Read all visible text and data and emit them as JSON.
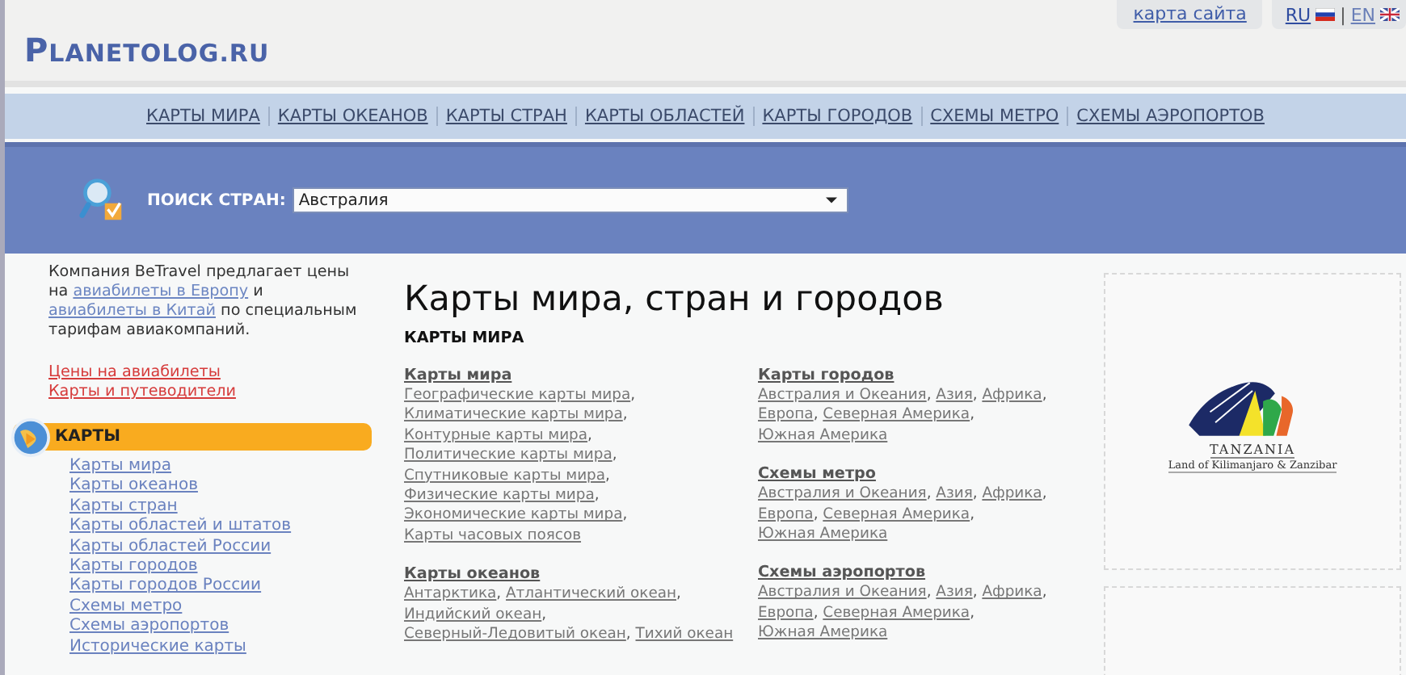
{
  "header": {
    "logo": "PLANETOLOG.RU",
    "sitemap_link": "карта сайта",
    "languages": [
      {
        "code": "RU",
        "selected": true
      },
      {
        "code": "EN",
        "selected": false
      }
    ],
    "language_separator": "|"
  },
  "nav": [
    "КАРТЫ МИРА",
    "КАРТЫ ОКЕАНОВ",
    "КАРТЫ СТРАН",
    "КАРТЫ ОБЛАСТЕЙ",
    "КАРТЫ ГОРОДОВ",
    "СХЕМЫ МЕТРО",
    "СХЕМЫ АЭРОПОРТОВ"
  ],
  "search": {
    "label": "ПОИСК СТРАН:",
    "value": "Австралия"
  },
  "sidebar": {
    "promo": [
      {
        "text": "Компания BeTravel предлагает цены на ",
        "link": false
      },
      {
        "text": "авиабилеты в Европу",
        "link": true
      },
      {
        "text": " и ",
        "link": false
      },
      {
        "text": "авиабилеты в Китай",
        "link": true
      },
      {
        "text": " по специальным тарифам авиакомпаний.",
        "link": false
      }
    ],
    "red_links": [
      "Цены на авиабилеты",
      "Карты и путеводители"
    ],
    "section_title": "КАРТЫ",
    "items": [
      "Карты мира",
      "Карты океанов",
      "Карты стран",
      "Карты областей и штатов",
      "Карты областей России",
      "Карты городов",
      "Карты городов России",
      "Схемы метро",
      "Схемы аэропортов",
      "Исторические карты"
    ]
  },
  "main": {
    "title": "Карты мира, стран и городов",
    "subtitle": "КАРТЫ МИРА",
    "columns": [
      [
        {
          "heading": "Карты мира",
          "links": [
            {
              "text": "Географические карты мира",
              "sep": ","
            },
            {
              "text": "Климатические карты мира",
              "sep": ","
            },
            {
              "text": "Контурные карты мира",
              "sep": ","
            },
            {
              "text": "Политические карты мира",
              "sep": ","
            },
            {
              "text": "Спутниковые карты мира",
              "sep": ","
            },
            {
              "text": "Физические карты мира",
              "sep": ","
            },
            {
              "text": "Экономические карты мира",
              "sep": ","
            },
            {
              "text": "Карты часовых поясов"
            }
          ]
        },
        {
          "heading": "Карты океанов",
          "links": [
            {
              "text": "Антарктика",
              "sep": ","
            },
            {
              "text": "Атлантический океан",
              "sep": ","
            },
            {
              "text": "Индийский океан",
              "sep": ","
            },
            {
              "text": "Северный-Ледовитый океан",
              "sep": ","
            },
            {
              "text": "Тихий океан"
            }
          ]
        }
      ],
      [
        {
          "heading": "Карты городов",
          "links": [
            {
              "text": "Австралия и Океания",
              "sep": ","
            },
            {
              "text": "Азия",
              "sep": ","
            },
            {
              "text": "Африка",
              "sep": ","
            },
            {
              "text": "Европа",
              "sep": ","
            },
            {
              "text": "Северная Америка",
              "sep": ","
            },
            {
              "text": "Южная Америка"
            }
          ]
        },
        {
          "heading": "Схемы метро",
          "links": [
            {
              "text": "Австралия и Океания",
              "sep": ","
            },
            {
              "text": "Азия",
              "sep": ","
            },
            {
              "text": "Африка",
              "sep": ","
            },
            {
              "text": "Европа",
              "sep": ","
            },
            {
              "text": "Северная Америка",
              "sep": ","
            },
            {
              "text": "Южная Америка"
            }
          ]
        },
        {
          "heading": "Схемы аэропортов",
          "links": [
            {
              "text": "Австралия и Океания",
              "sep": ","
            },
            {
              "text": "Азия",
              "sep": ","
            },
            {
              "text": "Африка",
              "sep": ","
            },
            {
              "text": "Европа",
              "sep": ","
            },
            {
              "text": "Северная Америка",
              "sep": ","
            },
            {
              "text": "Южная Америка"
            }
          ]
        }
      ]
    ]
  },
  "ad": {
    "title": "TANZANIA",
    "tagline": "Land of Kilimanjaro & Zanzibar"
  }
}
